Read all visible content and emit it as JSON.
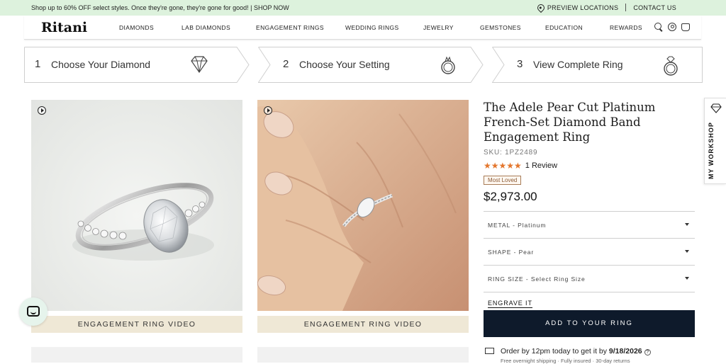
{
  "promo": {
    "message": "Shop up to 60% OFF select styles. Once they're gone, they're gone for good! | SHOP NOW",
    "preview_locations": "PREVIEW LOCATIONS",
    "contact_us": "CONTACT US",
    "background": "#ddf2dd"
  },
  "nav": {
    "logo": "Ritani",
    "links": [
      "DIAMONDS",
      "LAB DIAMONDS",
      "ENGAGEMENT RINGS",
      "WEDDING RINGS",
      "JEWELRY",
      "GEMSTONES",
      "EDUCATION",
      "REWARDS"
    ],
    "icons": [
      "search-icon",
      "account-icon",
      "cart-icon"
    ]
  },
  "steps": [
    {
      "number": "1",
      "label": "Choose Your Diamond",
      "icon": "diamond-icon"
    },
    {
      "number": "2",
      "label": "Choose Your Setting",
      "icon": "ring-setting-icon"
    },
    {
      "number": "3",
      "label": "View Complete Ring",
      "icon": "complete-ring-icon"
    }
  ],
  "media": [
    {
      "caption": "ENGAGEMENT RING VIDEO",
      "icon": "play-icon"
    },
    {
      "caption": "ENGAGEMENT RING VIDEO",
      "icon": "play-icon"
    }
  ],
  "product": {
    "title": "The Adele Pear Cut Platinum French-Set Diamond Band Engagement Ring",
    "sku": "SKU: 1PZ2489",
    "stars": "★★★★★",
    "star_rating": 5,
    "reviews": "1 Review",
    "badge": "Most Loved",
    "price": "$2,973.00",
    "options": [
      {
        "label": "METAL - Platinum"
      },
      {
        "label": "SHAPE - Pear"
      },
      {
        "label": "RING SIZE - Select Ring Size"
      }
    ],
    "engrave": "ENGRAVE IT",
    "add_button": "ADD TO YOUR RING",
    "shipping_prefix": "Order by 12pm today to get it by ",
    "shipping_date": "9/18/2026",
    "shipping_sub": "Free overnight shipping · Fully insured · 30-day returns",
    "accent": "#e4762c",
    "button_color": "#0e1a2b"
  },
  "workshop": {
    "label": "MY WORKSHOP"
  }
}
